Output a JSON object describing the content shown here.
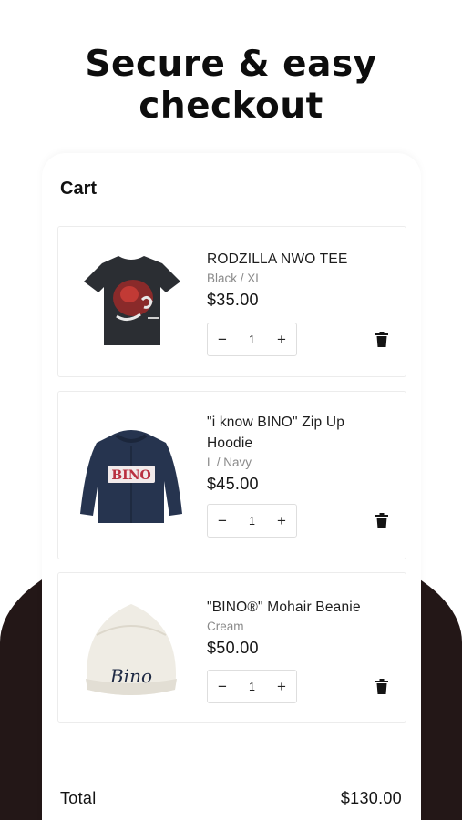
{
  "headline": {
    "line1": "Secure & easy",
    "line2": "checkout"
  },
  "cart": {
    "title": "Cart",
    "items": [
      {
        "name": "RODZILLA NWO TEE",
        "variant": "Black / XL",
        "price": "$35.00",
        "quantity": "1",
        "decrease": "−",
        "increase": "+",
        "image_icon": "black-tshirt-icon"
      },
      {
        "name": "\"i know BINO\" Zip Up Hoodie",
        "variant": "L / Navy",
        "price": "$45.00",
        "quantity": "1",
        "decrease": "−",
        "increase": "+",
        "image_icon": "navy-hoodie-icon",
        "image_text": "BINO"
      },
      {
        "name": "\"BINO®\" Mohair Beanie",
        "variant": "Cream",
        "price": "$50.00",
        "quantity": "1",
        "decrease": "−",
        "increase": "+",
        "image_icon": "cream-beanie-icon",
        "image_text": "Bino"
      }
    ],
    "total_label": "Total",
    "total_value": "$130.00"
  },
  "colors": {
    "background_dark": "#231717",
    "text": "#141414",
    "muted": "#8a8a8a",
    "border": "#ececec"
  }
}
